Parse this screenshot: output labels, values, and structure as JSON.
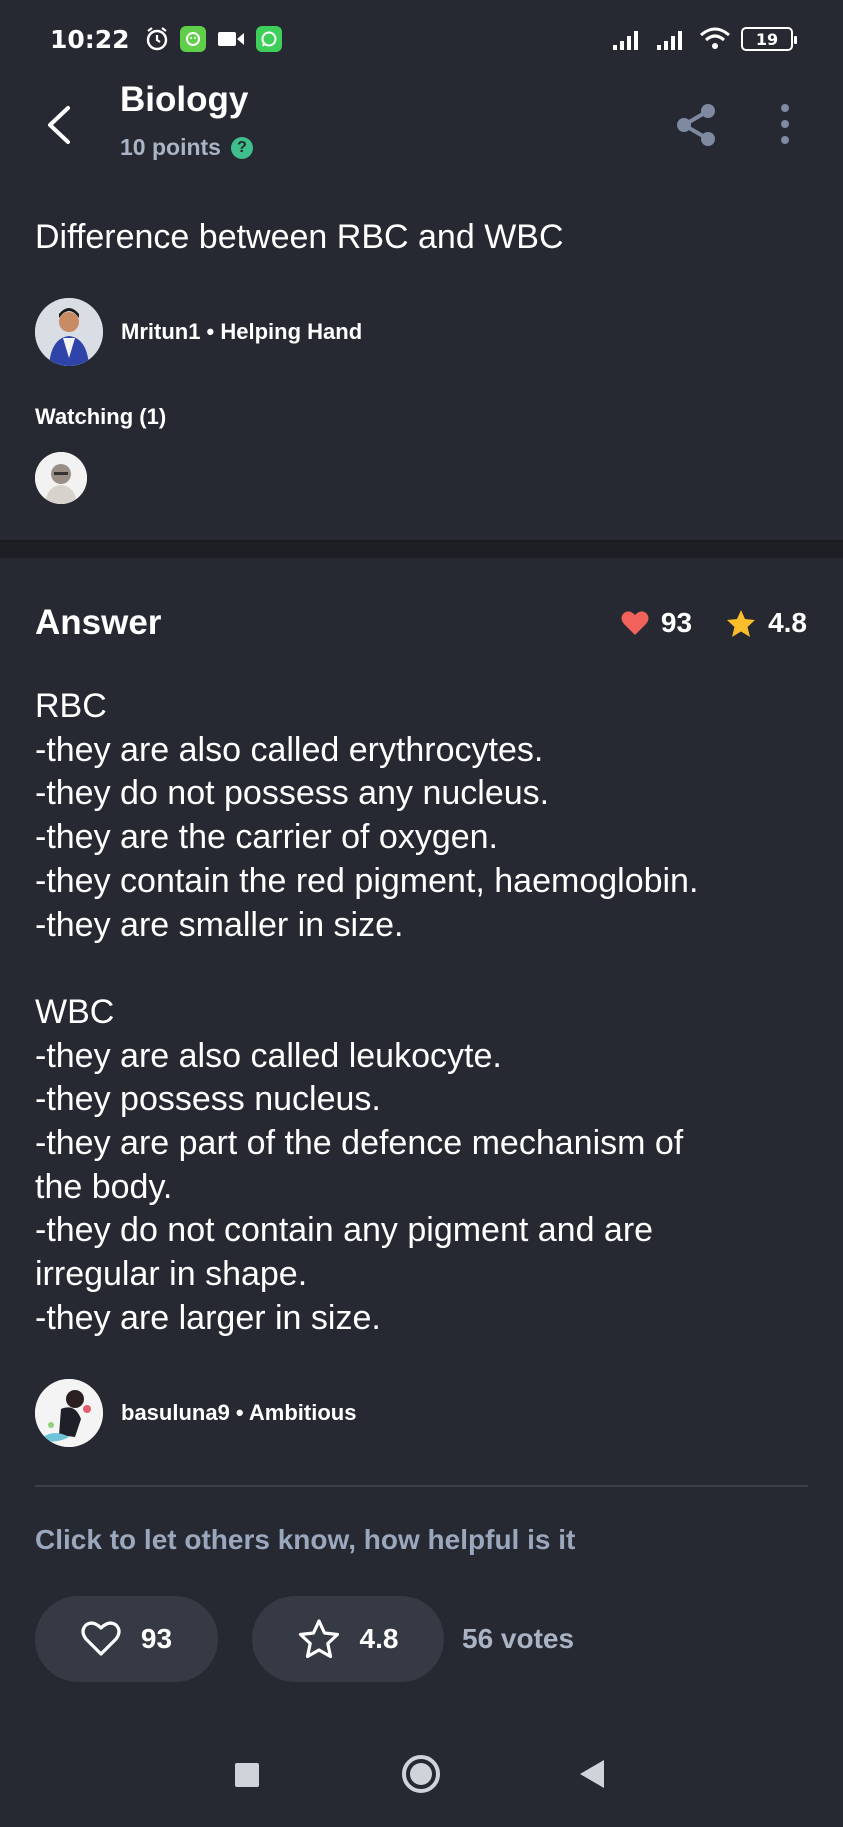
{
  "status_bar": {
    "time": "10:22",
    "battery": "19"
  },
  "header": {
    "subject": "Biology",
    "points": "10 points",
    "help_glyph": "?"
  },
  "question": {
    "text": "Difference between RBC and WBC",
    "asker": "Mritun1 • Helping Hand"
  },
  "watching": {
    "label": "Watching (1)"
  },
  "answer": {
    "heading": "Answer",
    "likes": "93",
    "rating": "4.8",
    "lines": [
      "RBC",
      "-they are also called erythrocytes.",
      "-they do not possess any nucleus.",
      "-they are the carrier of oxygen.",
      "-they contain the red pigment, haemoglobin.",
      "-they are smaller in size.",
      "",
      "WBC",
      "-they are also called leukocyte.",
      "-they possess nucleus.",
      "-they are part of the defence mechanism of",
      "the body.",
      "-they do not contain any pigment and are",
      "irregular in shape.",
      "-they are larger in size."
    ],
    "answerer": "basuluna9 • Ambitious"
  },
  "rating_section": {
    "prompt": "Click to let others know, how helpful is it",
    "like_count": "93",
    "rating": "4.8",
    "votes": "56 votes"
  },
  "colors": {
    "background": "#262931",
    "heart": "#f0625a",
    "star": "#fbbd2a",
    "accent_green": "#3fbf8c",
    "muted_text": "#9aa7bd"
  }
}
